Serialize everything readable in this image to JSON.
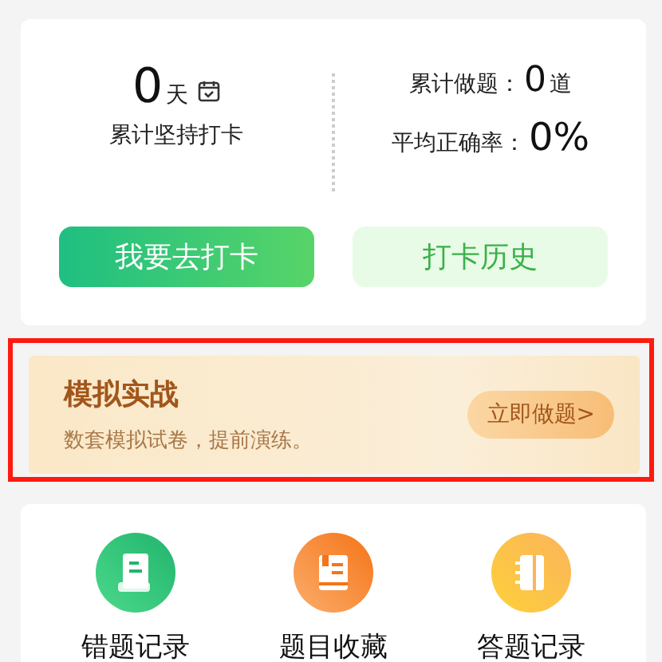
{
  "checkin": {
    "days": "0",
    "days_unit": "天",
    "days_label": "累计坚持打卡",
    "total_label": "累计做题：",
    "total_value": "0",
    "total_unit": "道",
    "accuracy_label": "平均正确率：",
    "accuracy_value": "0%"
  },
  "buttons": [
    {
      "label": "我要去打卡",
      "kind": "primary"
    },
    {
      "label": "打卡历史",
      "kind": "secondary"
    }
  ],
  "banner": {
    "title": "模拟实战",
    "subtitle": "数套模拟试卷，提前演练。",
    "button": "立即做题>",
    "highlighted": true
  },
  "shortcuts": [
    {
      "label": "错题记录",
      "kind": "mistakes"
    },
    {
      "label": "题目收藏",
      "kind": "favorites"
    },
    {
      "label": "答题记录",
      "kind": "history"
    }
  ]
}
